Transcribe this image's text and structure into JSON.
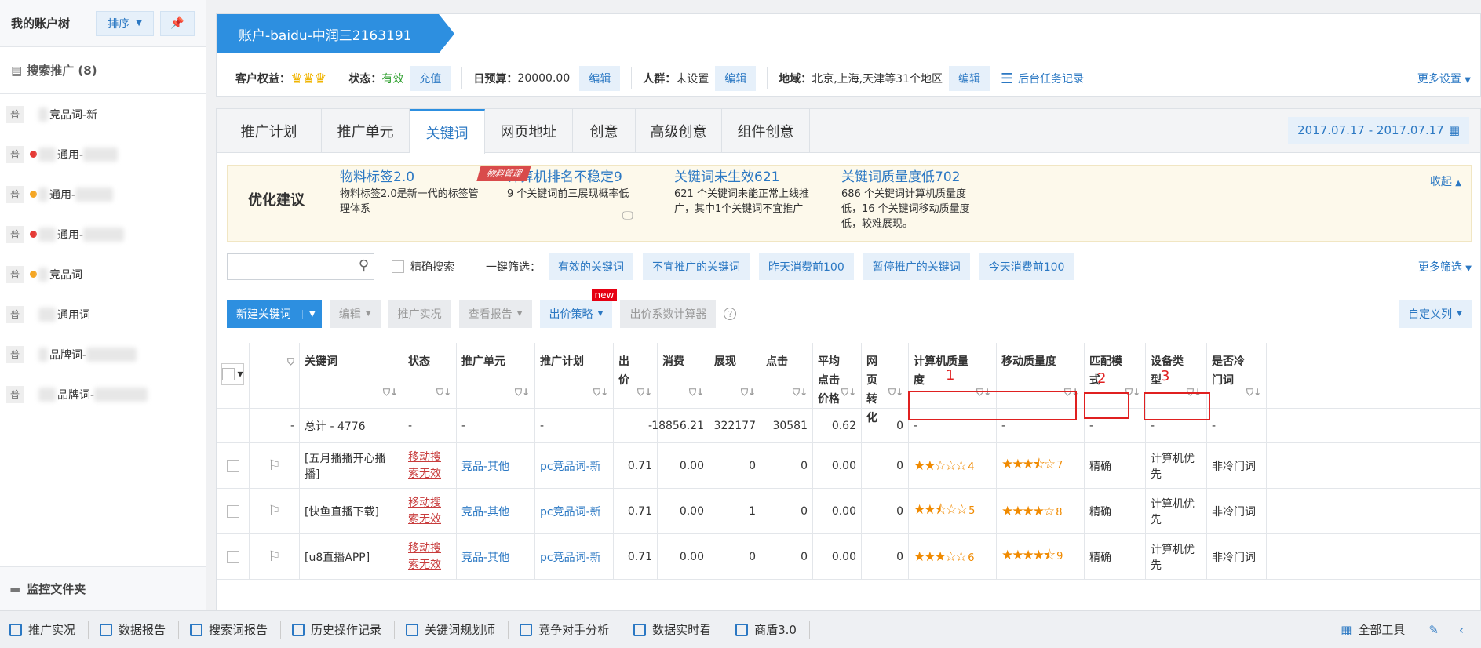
{
  "sidebar": {
    "title": "我的账户树",
    "sort_label": "排序",
    "section": "搜索推广 (8)",
    "footer": "监控文件夹",
    "items": [
      {
        "badge": "普",
        "dot": "",
        "label": "竞品词-新"
      },
      {
        "badge": "普",
        "dot": "#e53935",
        "label": "通用-"
      },
      {
        "badge": "普",
        "dot": "#f5a623",
        "label": "通用-"
      },
      {
        "badge": "普",
        "dot": "#e53935",
        "label": "通用-"
      },
      {
        "badge": "普",
        "dot": "#f5a623",
        "label": "竞品词"
      },
      {
        "badge": "普",
        "dot": "",
        "label": "通用词"
      },
      {
        "badge": "普",
        "dot": "",
        "label": "品牌词-"
      },
      {
        "badge": "普",
        "dot": "",
        "label": "品牌词-"
      }
    ]
  },
  "account": {
    "title": "账户-baidu-中润三2163191"
  },
  "info": {
    "rights_label": "客户权益：",
    "status_label": "状态：",
    "status_value": "有效",
    "recharge": "充值",
    "budget_label": "日预算：",
    "budget_value": "20000.00",
    "edit": "编辑",
    "crowd_label": "人群：",
    "crowd_value": "未设置",
    "region_label": "地域：",
    "region_value": "北京,上海,天津等31个地区",
    "task_log": "后台任务记录",
    "more_settings": "更多设置"
  },
  "tabs": [
    "推广计划",
    "推广单元",
    "关键词",
    "网页地址",
    "创意",
    "高级创意",
    "组件创意"
  ],
  "date_range": "2017.07.17 - 2017.07.17",
  "advice": {
    "title": "优化建议",
    "collapse": "收起",
    "tag": "物料管理",
    "cols": [
      {
        "h": "物料标签2.0",
        "d": "物料标签2.0是新一代的标签管理体系"
      },
      {
        "h": "计算机排名不稳定9",
        "d": "9 个关键词前三展现概率低"
      },
      {
        "h": "关键词未生效621",
        "d": "621 个关键词未能正常上线推广，其中1个关键词不宜推广"
      },
      {
        "h": "关键词质量度低702",
        "d": "686 个关键词计算机质量度低，16 个关键词移动质量度低，较难展现。"
      }
    ]
  },
  "filters": {
    "exact_search": "精确搜索",
    "quick_label": "一键筛选：",
    "buttons": [
      "有效的关键词",
      "不宜推广的关键词",
      "昨天消费前100",
      "暂停推广的关键词",
      "今天消费前100"
    ],
    "more": "更多筛选"
  },
  "toolbar": {
    "new_keyword": "新建关键词",
    "edit": "编辑",
    "live": "推广实况",
    "report": "查看报告",
    "bid_strategy": "出价策略",
    "new_badge": "new",
    "coef_calc": "出价系数计算器",
    "custom_cols": "自定义列"
  },
  "table": {
    "headers": [
      "关键词",
      "状态",
      "推广单元",
      "推广计划",
      "出价",
      "消费",
      "展现",
      "点击",
      "平均点击价格",
      "网页转化",
      "计算机质量度",
      "移动质量度",
      "匹配模式",
      "设备类型",
      "是否冷门词"
    ],
    "total": {
      "label": "总计 - 4776",
      "status": "-",
      "unit": "-",
      "plan": "-",
      "bid": "-",
      "cost": "18856.21",
      "impr": "322177",
      "clicks": "30581",
      "avg": "0.62",
      "conv": "0",
      "pc": "-",
      "mobile": "-",
      "match": "-",
      "device": "-",
      "cold": "-"
    },
    "rows": [
      {
        "kw": "[五月播播开心播播]",
        "status": "移动搜索无效",
        "unit": "竞品-其他",
        "plan": "pc竞品词-新",
        "bid": "0.71",
        "cost": "0.00",
        "impr": "0",
        "clicks": "0",
        "avg": "0.00",
        "conv": "0",
        "pc_stars": 2,
        "pc_score": "4",
        "mob_stars": 3.5,
        "mob_score": "7",
        "match": "精确",
        "device": "计算机优先",
        "cold": "非冷门词"
      },
      {
        "kw": "[快鱼直播下载]",
        "status": "移动搜索无效",
        "unit": "竞品-其他",
        "plan": "pc竞品词-新",
        "bid": "0.71",
        "cost": "0.00",
        "impr": "1",
        "clicks": "0",
        "avg": "0.00",
        "conv": "0",
        "pc_stars": 2.5,
        "pc_score": "5",
        "mob_stars": 4,
        "mob_score": "8",
        "match": "精确",
        "device": "计算机优先",
        "cold": "非冷门词"
      },
      {
        "kw": "[u8直播APP]",
        "status": "移动搜索无效",
        "unit": "竞品-其他",
        "plan": "pc竞品词-新",
        "bid": "0.71",
        "cost": "0.00",
        "impr": "0",
        "clicks": "0",
        "avg": "0.00",
        "conv": "0",
        "pc_stars": 3,
        "pc_score": "6",
        "mob_stars": 4.5,
        "mob_score": "9",
        "match": "精确",
        "device": "计算机优先",
        "cold": "非冷门词"
      }
    ]
  },
  "annotations": [
    "1",
    "2",
    "3"
  ],
  "bottom": {
    "items": [
      "推广实况",
      "数据报告",
      "搜索词报告",
      "历史操作记录",
      "关键词规划师",
      "竞争对手分析",
      "数据实时看",
      "商盾3.0"
    ],
    "all_tools": "全部工具"
  }
}
